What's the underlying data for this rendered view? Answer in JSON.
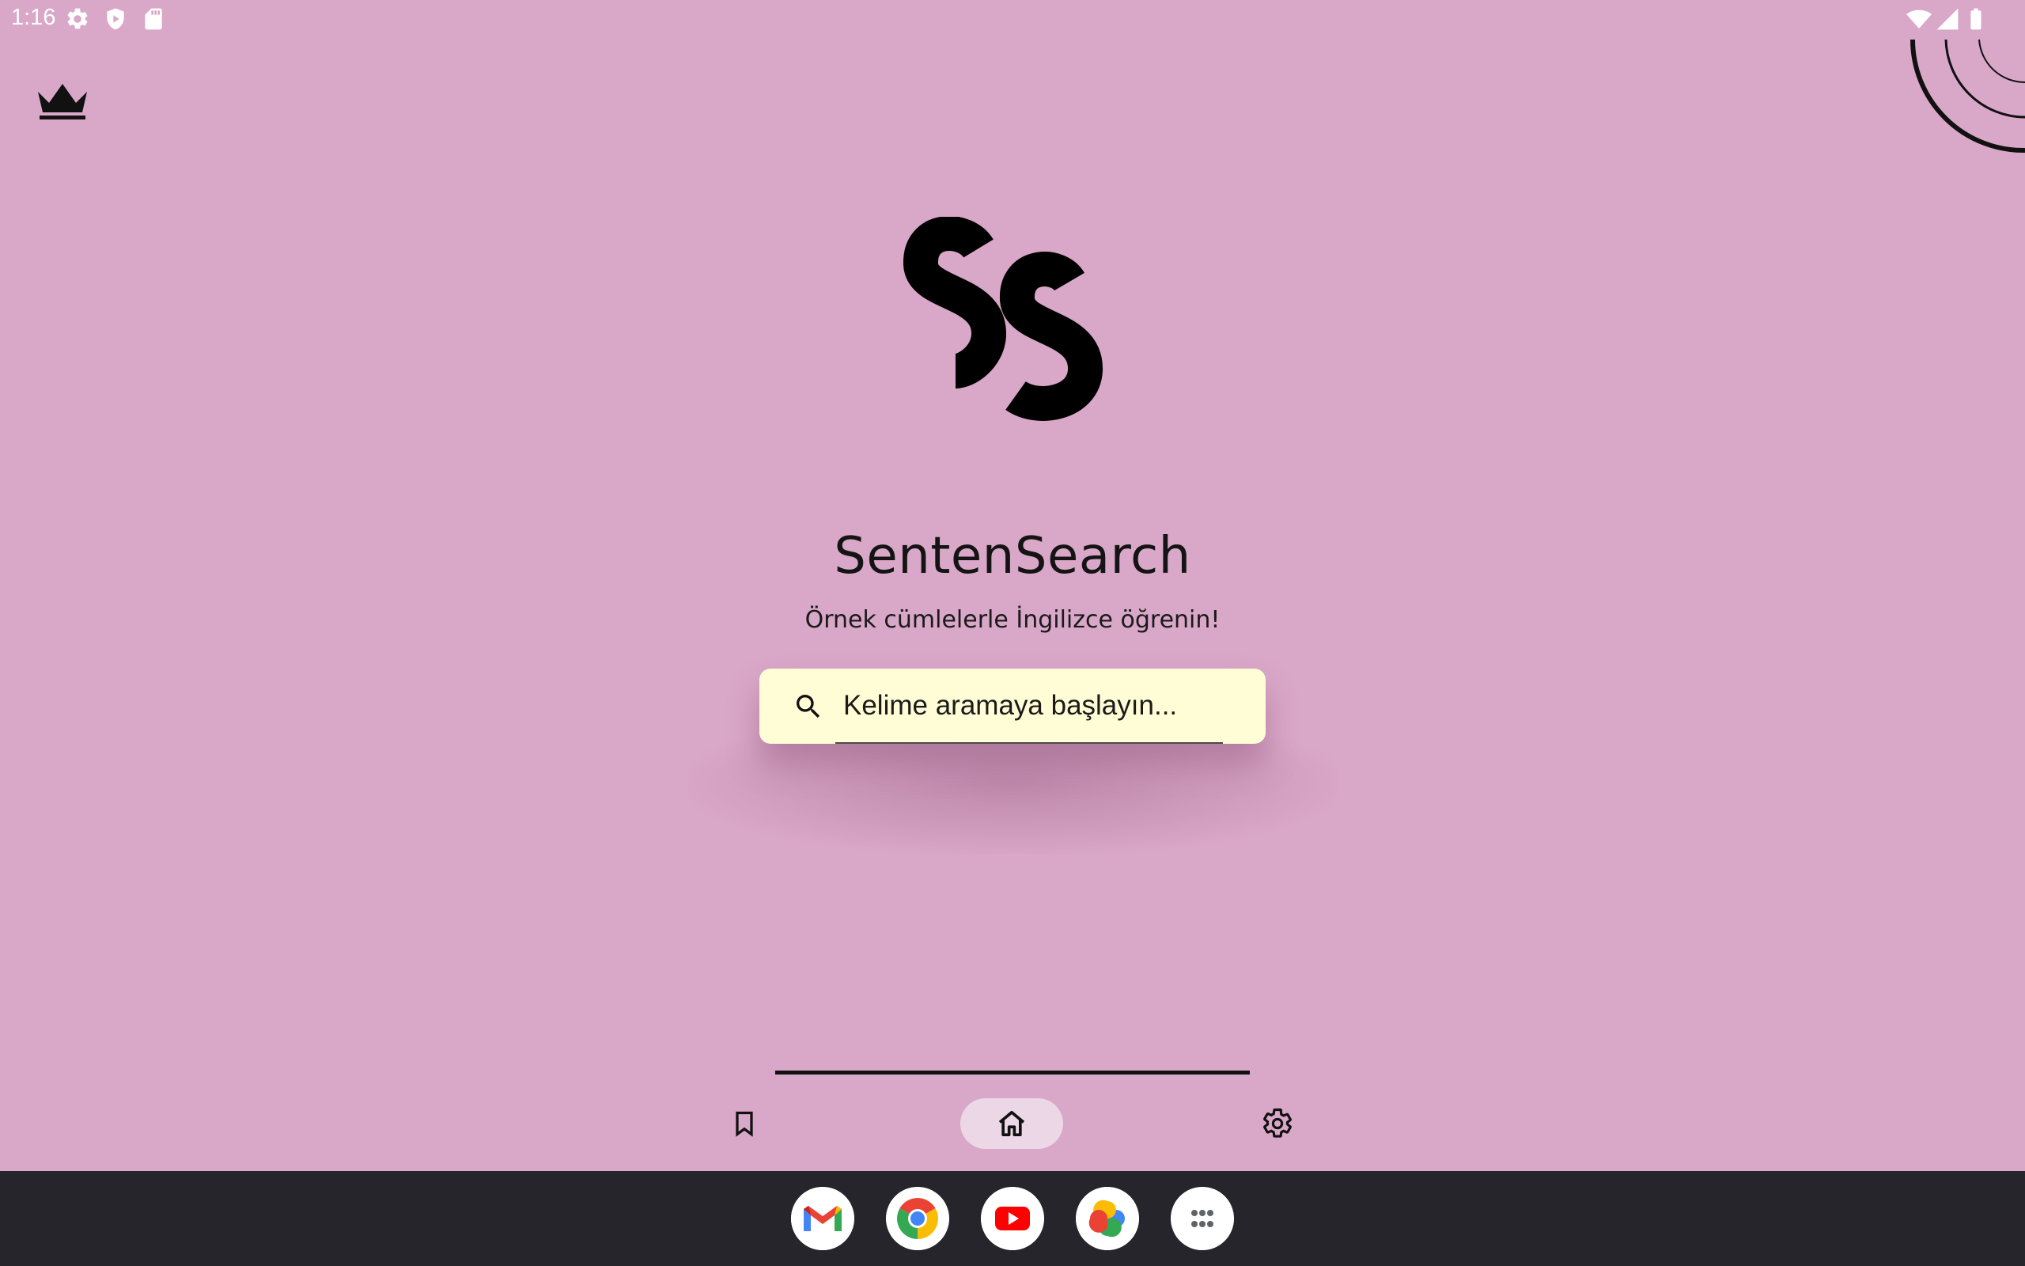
{
  "status_bar": {
    "time": "1:16",
    "left_icons": [
      "settings-icon",
      "shield-play-icon",
      "sd-card-icon"
    ],
    "right_icons": [
      "wifi-icon",
      "signal-icon",
      "battery-icon"
    ]
  },
  "header": {
    "premium_icon": "crown-icon"
  },
  "main": {
    "logo_icon": "sentensearch-logo",
    "title": "SentenSearch",
    "subtitle": "Örnek cümlelerle İngilizce öğrenin!",
    "search": {
      "placeholder": "Kelime aramaya başlayın...",
      "value": ""
    }
  },
  "bottom_nav": {
    "items": [
      {
        "icon": "bookmark-icon",
        "selected": false
      },
      {
        "icon": "home-icon",
        "selected": true
      },
      {
        "icon": "gear-icon",
        "selected": false
      }
    ]
  },
  "taskbar": {
    "apps": [
      "gmail-icon",
      "chrome-icon",
      "youtube-icon",
      "photos-icon",
      "app-drawer-icon"
    ]
  },
  "colors": {
    "background": "#d9a7c7",
    "search_box": "#fffdd6",
    "nav_selected_pill": "#ecd7e7",
    "taskbar": "#26252b",
    "text_dark": "#141414"
  }
}
